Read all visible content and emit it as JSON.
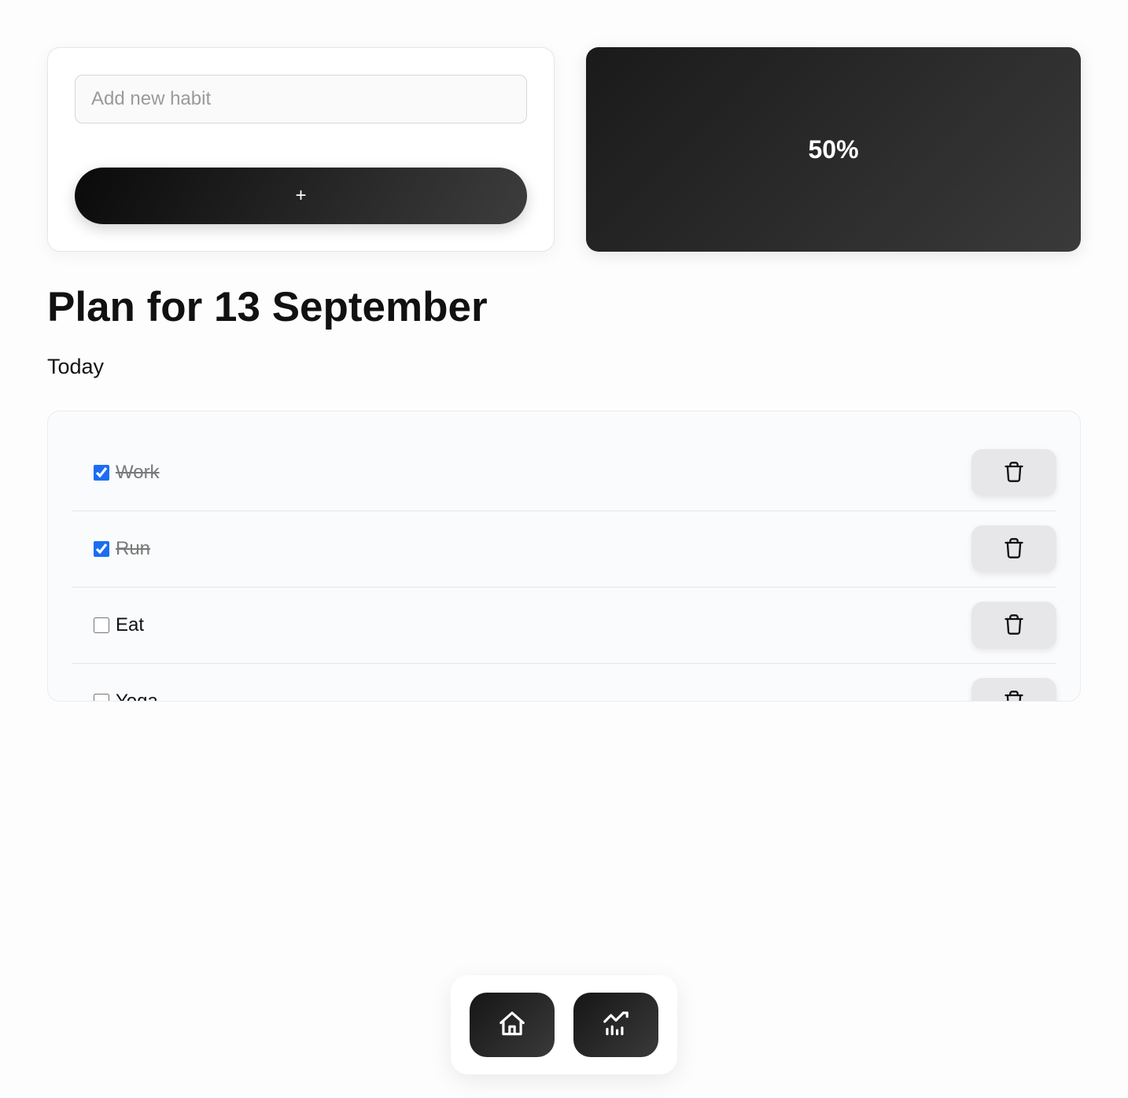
{
  "input": {
    "placeholder": "Add new habit"
  },
  "add_button_label": "+",
  "progress": "50%",
  "heading": "Plan for 13 September",
  "subheading": "Today",
  "habits": [
    {
      "label": "Work",
      "done": true
    },
    {
      "label": "Run",
      "done": true
    },
    {
      "label": "Eat",
      "done": false
    },
    {
      "label": "Yoga",
      "done": false
    }
  ]
}
